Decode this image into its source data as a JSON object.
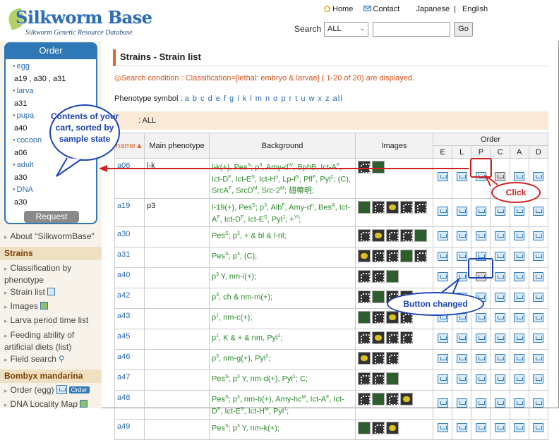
{
  "header": {
    "logo_title": "Silkworm Base",
    "logo_subtitle": "Silkworm Genetic Resource Database",
    "links": [
      "Home",
      "Contact",
      "Japanese",
      "English"
    ],
    "search_label": "Search",
    "search_scope": "ALL",
    "search_value": "",
    "go_label": "Go"
  },
  "sidebar": {
    "order_title": "Order",
    "cart": [
      {
        "stage": "egg",
        "items": "a19 , a30 , a31"
      },
      {
        "stage": "larva",
        "items": "a31"
      },
      {
        "stage": "pupa",
        "items": "a40"
      },
      {
        "stage": "cocoon",
        "items": "a06"
      },
      {
        "stage": "adult",
        "items": "a30"
      },
      {
        "stage": "DNA",
        "items": "a30"
      }
    ],
    "request_label": "Request",
    "about": "About \"SilkwormBase\"",
    "strains_head": "Strains",
    "strains_links": [
      "Classification by phenotype",
      "Strain list",
      "Images",
      "Larva period time list",
      "Feeding ability of artificial diets (list)",
      "Field search"
    ],
    "mandarina_head": "Bombyx mandarina",
    "mandarina_links": [
      "Order (egg)",
      "DNA Locality Map"
    ],
    "order_chip": "Order"
  },
  "main": {
    "title": "Strains - Strain list",
    "condition": "◎Search condition : Classification=[lethal: embryo & larvae] ( 1-20 of 20) are displayed.",
    "pheno_label": "Phenotype symbol :",
    "pheno_letters": "a b c d e f g i k l m n o p r t u w x z all",
    "filter_text": ": ALL",
    "headers": {
      "name": "name",
      "main": "Main phenotype",
      "background": "Background",
      "images": "Images",
      "order": "Order",
      "order_cols": [
        "E",
        "L",
        "P",
        "C",
        "A",
        "D"
      ]
    },
    "rows": [
      {
        "name": "a06",
        "main": "l-k",
        "background": "l-k(+), Pes^S; p^3, Amy-d^IV, BphB, Ict-A^F, Ict-D^F, Ict-E^S, Ict-H^n, Lp-f^S, Pfl^F, Pyl^2; (C), SrcA^F, SrcD^M, Src-2^M; 翅蔕明;",
        "images": 2
      },
      {
        "name": "a19",
        "main": "p3",
        "background": "l-19(+), Pes^S; p^3, Alb^F, Amy-d^n, Bes^A, Ict-A^F, Ict-D^F, Ict-E^S, Pyl^1; +^Yf;",
        "images": 5
      },
      {
        "name": "a30",
        "main": "",
        "background": "Pes^S; p^3, + & bl & l-nl;",
        "images": 5
      },
      {
        "name": "a31",
        "main": "",
        "background": "Pes^S; p^3; (C);",
        "images": 5
      },
      {
        "name": "a40",
        "main": "",
        "background": "p^3 Y, nm-i(+);",
        "images": 3
      },
      {
        "name": "a42",
        "main": "",
        "background": "p^3, ch & nm-m(+);",
        "images": 4
      },
      {
        "name": "a43",
        "main": "",
        "background": "p^1, nm-c(+);",
        "images": 4
      },
      {
        "name": "a45",
        "main": "",
        "background": "p^1, K & + & nm, Pyl^1;",
        "images": 4
      },
      {
        "name": "a46",
        "main": "",
        "background": "p^3, nm-g(+), Pyl^2;",
        "images": 3
      },
      {
        "name": "a47",
        "main": "",
        "background": "Pes^S; p^3 Y, nm-d(+), Pyl^1; C;",
        "images": 3
      },
      {
        "name": "a48",
        "main": "",
        "background": "Pes^S; p^3, nm-b(+), Amy-hc^M, Ict-A^F, Ict-D^F, Ict-E^S, Ict-H^M, Pyl^1;",
        "images": 4
      },
      {
        "name": "a49",
        "main": "",
        "background": "Pes^S; p^3 Y, nm-k(+);",
        "images": 3
      }
    ]
  },
  "annotations": {
    "cart_note": "Contents of your cart, sorted by sample state",
    "click_note": "Click",
    "changed_note": "Button changed"
  }
}
